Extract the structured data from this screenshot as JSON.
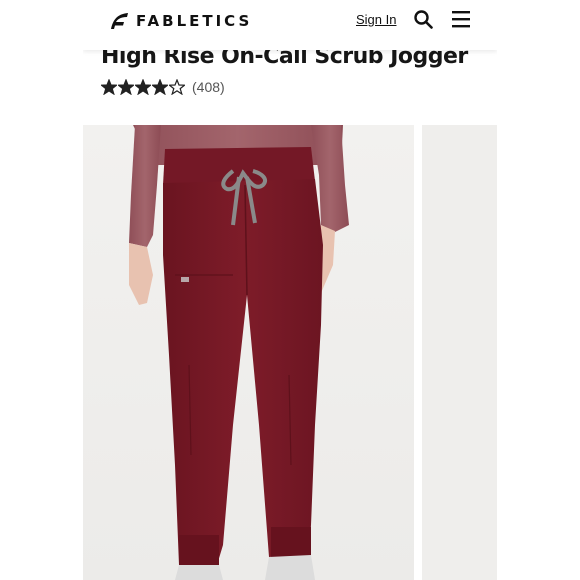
{
  "header": {
    "brand": "FABLETICS",
    "sign_in": "Sign In",
    "search_icon": "search-icon",
    "menu_icon": "hamburger-menu-icon"
  },
  "product": {
    "title": "High Rise On-Call Scrub Jogger",
    "rating": 4,
    "rating_max": 5,
    "review_count": "(408)"
  },
  "colors": {
    "brand_text": "#111111",
    "pants": "#7b1a26",
    "drawstring": "#8a8a8a",
    "shirt": "#9a5a62"
  }
}
